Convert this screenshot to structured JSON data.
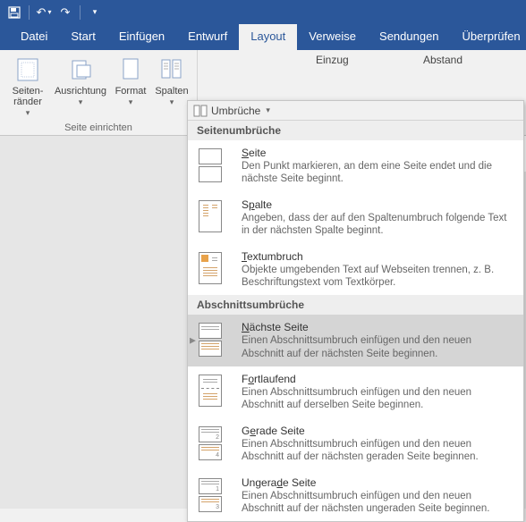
{
  "titlebar": {
    "save": "💾",
    "undo": "↶",
    "redo": "↷"
  },
  "tabs": [
    "Datei",
    "Start",
    "Einfügen",
    "Entwurf",
    "Layout",
    "Verweise",
    "Sendungen",
    "Überprüfen"
  ],
  "activeTab": 4,
  "ribbon": {
    "margins": "Seiten-\nränder",
    "orient": "Ausrichtung",
    "format": "Format",
    "columns": "Spalten",
    "groupLabel": "Seite einrichten",
    "breaks": "Umbrüche",
    "indent": "Einzug",
    "spacing": "Abstand"
  },
  "dropdown": {
    "sec1": "Seitenumbrüche",
    "items1": [
      {
        "title": "Seite",
        "desc": "Den Punkt markieren, an dem eine Seite endet und die nächste Seite beginnt."
      },
      {
        "title": "Spalte",
        "desc": "Angeben, dass der auf den Spaltenumbruch folgende Text in der nächsten Spalte beginnt."
      },
      {
        "title": "Textumbruch",
        "desc": "Objekte umgebenden Text auf Webseiten trennen, z. B. Beschriftungstext vom Textkörper."
      }
    ],
    "sec2": "Abschnittsumbrüche",
    "items2": [
      {
        "title": "Nächste Seite",
        "desc": "Einen Abschnittsumbruch einfügen und den neuen Abschnitt auf der nächsten Seite beginnen."
      },
      {
        "title": "Fortlaufend",
        "desc": "Einen Abschnittsumbruch einfügen und den neuen Abschnitt auf derselben Seite beginnen."
      },
      {
        "title": "Gerade Seite",
        "desc": "Einen Abschnittsumbruch einfügen und den neuen Abschnitt auf der nächsten geraden Seite beginnen."
      },
      {
        "title": "Ungerade Seite",
        "desc": "Einen Abschnittsumbruch einfügen und den neuen Abschnitt auf der nächsten ungeraden Seite beginnen."
      }
    ]
  }
}
